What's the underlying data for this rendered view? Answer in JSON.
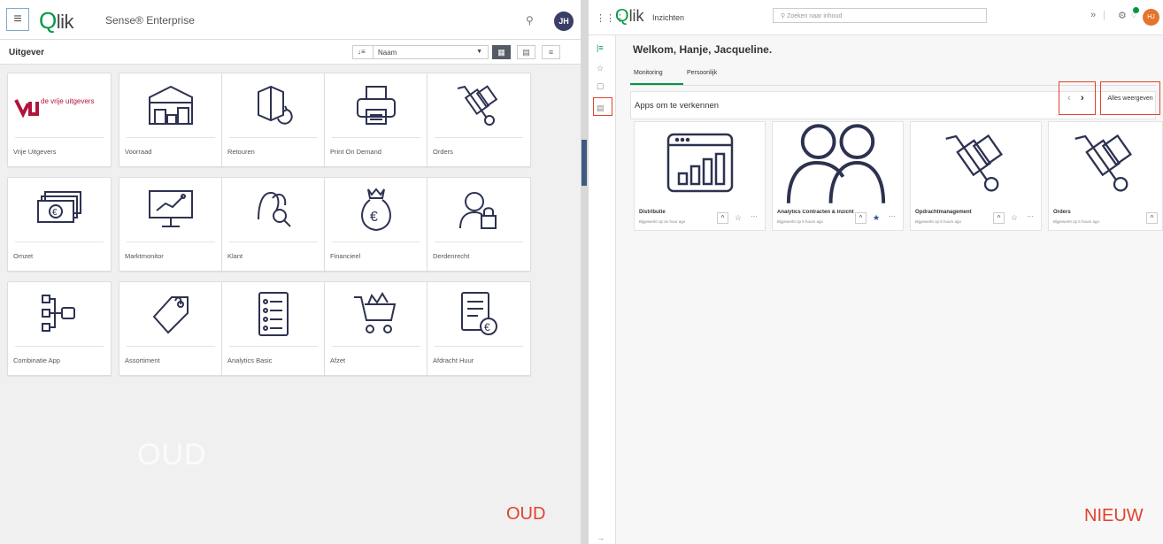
{
  "left": {
    "logo": "Qlik",
    "product": "Sense® Enterprise",
    "avatar": "JH",
    "publisher": "Uitgever",
    "sort_label": "Naam",
    "tag": "OUD",
    "ghost": "OUD",
    "tiles": [
      {
        "label": "Vrije Uitgevers",
        "icon": "vrije-uitgevers-logo",
        "logo_text": "de vrije uitgevers"
      },
      {
        "label": "Voorraad",
        "icon": "warehouse-icon"
      },
      {
        "label": "Retouren",
        "icon": "return-box-icon"
      },
      {
        "label": "Print On Demand",
        "icon": "printer-icon"
      },
      {
        "label": "Orders",
        "icon": "hand-truck-icon"
      },
      {
        "label": "Omzet",
        "icon": "money-stack-icon"
      },
      {
        "label": "Marktmonitor",
        "icon": "monitor-chart-icon"
      },
      {
        "label": "Klant",
        "icon": "customer-search-icon"
      },
      {
        "label": "Financieel",
        "icon": "money-bag-icon"
      },
      {
        "label": "Derdenrecht",
        "icon": "user-lock-icon"
      },
      {
        "label": "Combinatie App",
        "icon": "flow-diagram-icon"
      },
      {
        "label": "Assortiment",
        "icon": "price-tag-icon"
      },
      {
        "label": "Analytics Basic",
        "icon": "checklist-icon"
      },
      {
        "label": "Afzet",
        "icon": "shopping-cart-icon"
      },
      {
        "label": "Afdracht Huur",
        "icon": "invoice-euro-icon"
      }
    ]
  },
  "right": {
    "logo": "Qlik",
    "section": "Inzichten",
    "search_placeholder": "Zoeken naar inhoud",
    "avatar": "HJ",
    "welcome": "Welkom, Hanje, Jacqueline.",
    "tabs": [
      "Monitoring",
      "Persoonlijk"
    ],
    "apps_title": "Apps om te verkennen",
    "show_all": "Alles weergeven",
    "tag": "NIEUW",
    "cards": [
      {
        "name": "Distributie",
        "sub": "Bijgewerkt op an hour ago",
        "icon": "bar-chart-window-icon",
        "starred": false
      },
      {
        "name": "Analytics Contracten & Inzicht",
        "sub": "Bijgewerkt op 5 hours ago",
        "icon": "group-users-icon",
        "starred": true
      },
      {
        "name": "Opdrachtmanagement",
        "sub": "Bijgewerkt op 5 hours ago",
        "icon": "hand-truck-icon",
        "starred": false
      },
      {
        "name": "Orders",
        "sub": "Bijgewerkt op 5 hours ago",
        "icon": "hand-truck-icon",
        "starred": false
      }
    ]
  },
  "colors": {
    "qlik_green": "#009845",
    "highlight_red": "#e2432b",
    "icon_navy": "#2d3250"
  }
}
